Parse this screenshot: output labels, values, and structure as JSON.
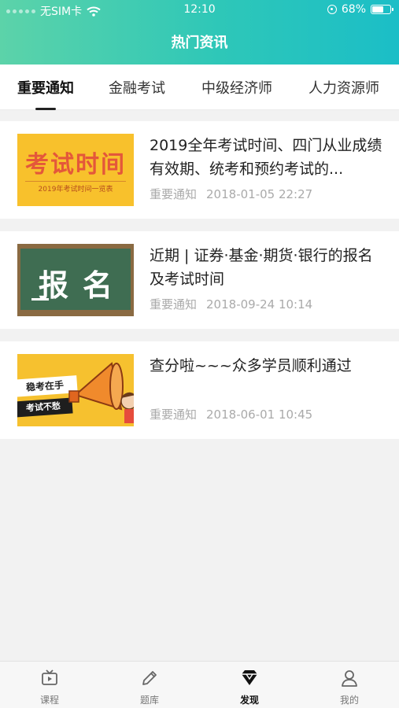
{
  "status_bar": {
    "carrier": "无SIM卡",
    "time": "12:10",
    "battery": "68%",
    "battery_level": 0.68
  },
  "header": {
    "title": "热门资讯"
  },
  "tabs": [
    {
      "label": "重要通知",
      "active": true
    },
    {
      "label": "金融考试",
      "active": false
    },
    {
      "label": "中级经济师",
      "active": false
    },
    {
      "label": "人力资源师",
      "active": false
    }
  ],
  "articles": [
    {
      "title": "2019全年考试时间、四门从业成绩有效期、统考和预约考试的...",
      "category": "重要通知",
      "date": "2018-01-05 22:27",
      "thumb_text": "考试时间",
      "thumb_subtext": "2019年考试时间一览表"
    },
    {
      "title": "近期 | 证券·基金·期货·银行的报名及考试时间",
      "category": "重要通知",
      "date": "2018-09-24 10:14",
      "thumb_text": "报名"
    },
    {
      "title": "查分啦~~~众多学员顺利通过",
      "category": "重要通知",
      "date": "2018-06-01 10:45",
      "thumb_text": "稳考在手",
      "thumb_subtext": "考试不愁"
    }
  ],
  "bottom_nav": [
    {
      "label": "课程",
      "icon": "tv-icon",
      "active": false
    },
    {
      "label": "题库",
      "icon": "pencil-icon",
      "active": false
    },
    {
      "label": "发现",
      "icon": "diamond-icon",
      "active": true
    },
    {
      "label": "我的",
      "icon": "user-icon",
      "active": false
    }
  ],
  "colors": {
    "header_start": "#5cd3a9",
    "header_end": "#1bbec7",
    "background": "#f2f2f2"
  }
}
